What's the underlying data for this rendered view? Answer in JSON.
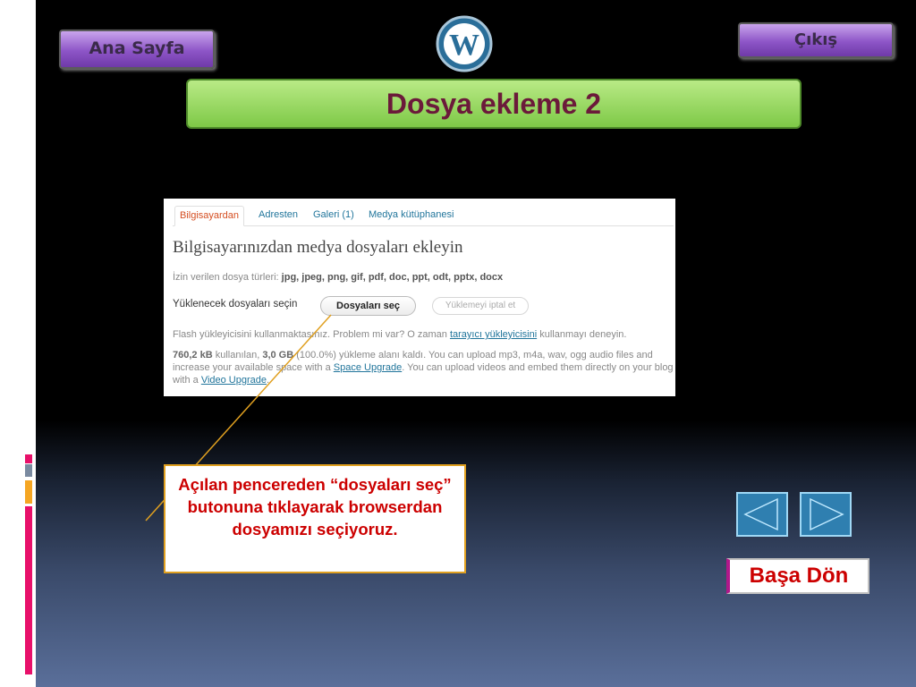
{
  "nav": {
    "home_label": "Ana Sayfa",
    "exit_label": "Çıkış",
    "back_to_start_label": "Başa Dön",
    "prev_icon": "triangle-left-icon",
    "next_icon": "triangle-right-icon"
  },
  "logo": {
    "icon": "wordpress-logo",
    "letter": "W"
  },
  "slide": {
    "title": "Dosya ekleme 2"
  },
  "uploader": {
    "tabs": [
      "Bilgisayardan",
      "Adresten",
      "Galeri (1)",
      "Medya kütüphanesi"
    ],
    "active_tab": "Bilgisayardan",
    "heading": "Bilgisayarınızdan medya dosyaları ekleyin",
    "allowed_prefix": "İzin verilen dosya türleri:",
    "allowed_types": "jpg, jpeg, png, gif, pdf, doc, ppt, odt, pptx, docx",
    "select_label": "Yüklenecek dosyaları seçin",
    "choose_button": "Dosyaları seç",
    "cancel_button": "Yüklemeyi iptal et",
    "flash_text_1": "Flash yükleyicisini kullanmaktasınız. Problem mi var? O zaman",
    "flash_link": "tarayıcı yükleyicisini",
    "flash_text_2": "kullanmayı deneyin.",
    "usage_used": "760,2 kB",
    "usage_text_1": "kullanılan,",
    "usage_free": "3,0 GB",
    "usage_pct": "(100.0%)",
    "usage_text_2": "yükleme alanı kaldı. You can upload mp3, m4a, wav, ogg audio files and increase your available space with a",
    "space_link": "Space Upgrade",
    "usage_text_3": ". You can upload videos and embed them directly on your blog with a",
    "video_link": "Video Upgrade",
    "usage_end": "."
  },
  "callout": {
    "text": "Açılan pencereden “dosyaları seç”  butonuna tıklayarak browserdan dosyamızı seçiyoruz."
  },
  "colors": {
    "title_text": "#6b1a3a",
    "callout_text": "#cc0000",
    "callout_border": "#e0a020",
    "pointer_line": "#e0a020",
    "tab_active": "#d54e21",
    "link": "#21759b"
  }
}
